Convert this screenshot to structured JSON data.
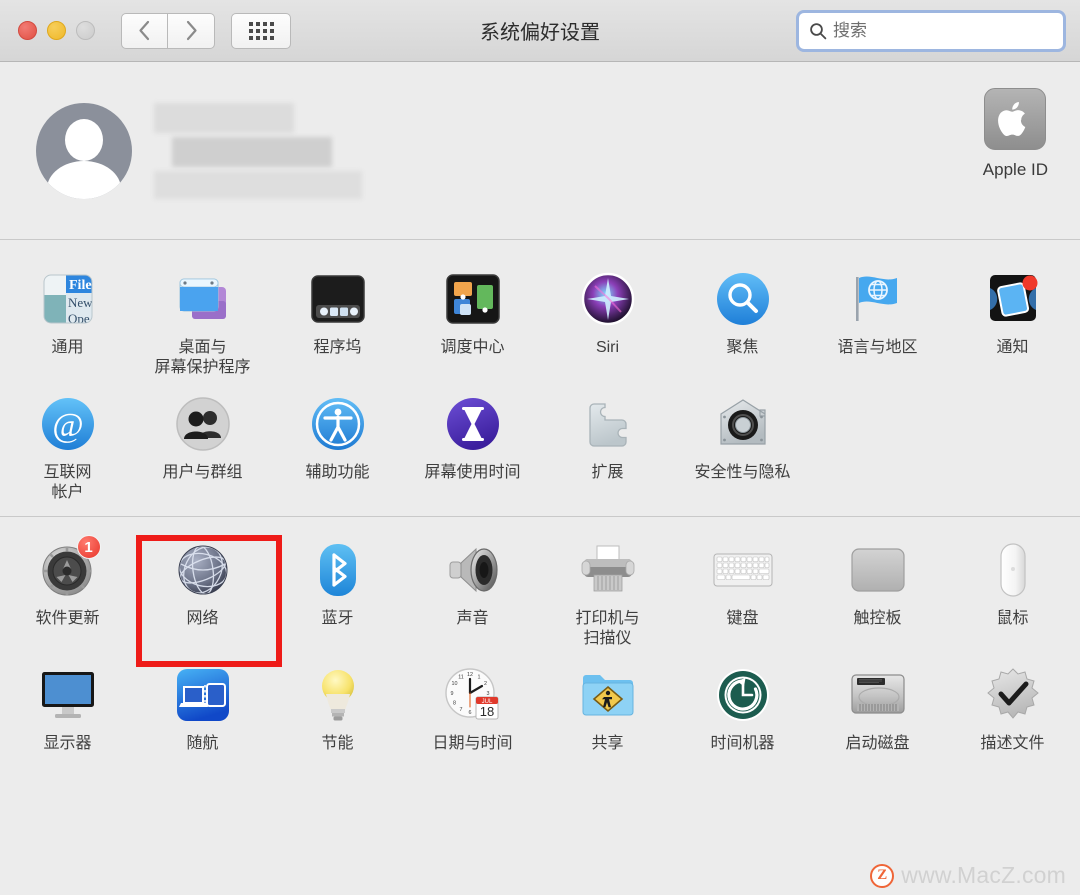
{
  "window": {
    "title": "系统偏好设置",
    "traffic_lights": [
      "close",
      "minimize",
      "zoom"
    ],
    "nav_back_label": "‹",
    "nav_forward_label": "›",
    "grid_button_label": "show-all"
  },
  "search": {
    "placeholder": "搜索",
    "value": "",
    "focused": true,
    "focus_ring_color": "#9db6e0"
  },
  "account": {
    "name_redacted": true,
    "apple_id": {
      "label": "Apple ID",
      "icon": "apple-logo-icon"
    }
  },
  "sections": [
    {
      "id": "section-general",
      "items": [
        {
          "label": "通用",
          "icon": "general-icon"
        },
        {
          "label": "桌面与\n屏幕保护程序",
          "icon": "desktop-screensaver-icon"
        },
        {
          "label": "程序坞",
          "icon": "dock-icon"
        },
        {
          "label": "调度中心",
          "icon": "mission-control-icon"
        },
        {
          "label": "Siri",
          "icon": "siri-icon"
        },
        {
          "label": "聚焦",
          "icon": "spotlight-icon"
        },
        {
          "label": "语言与地区",
          "icon": "language-region-icon"
        },
        {
          "label": "通知",
          "icon": "notifications-icon"
        },
        {
          "label": "互联网\n帐户",
          "icon": "internet-accounts-icon"
        },
        {
          "label": "用户与群组",
          "icon": "users-groups-icon"
        },
        {
          "label": "辅助功能",
          "icon": "accessibility-icon"
        },
        {
          "label": "屏幕使用时间",
          "icon": "screen-time-icon"
        },
        {
          "label": "扩展",
          "icon": "extensions-icon"
        },
        {
          "label": "安全性与隐私",
          "icon": "security-privacy-icon"
        }
      ]
    },
    {
      "id": "section-hardware",
      "items": [
        {
          "label": "软件更新",
          "icon": "software-update-icon",
          "badge": "1"
        },
        {
          "label": "网络",
          "icon": "network-icon",
          "highlighted": true
        },
        {
          "label": "蓝牙",
          "icon": "bluetooth-icon"
        },
        {
          "label": "声音",
          "icon": "sound-icon"
        },
        {
          "label": "打印机与\n扫描仪",
          "icon": "printers-scanners-icon"
        },
        {
          "label": "键盘",
          "icon": "keyboard-icon"
        },
        {
          "label": "触控板",
          "icon": "trackpad-icon"
        },
        {
          "label": "鼠标",
          "icon": "mouse-icon"
        },
        {
          "label": "显示器",
          "icon": "displays-icon"
        },
        {
          "label": "随航",
          "icon": "sidecar-icon"
        },
        {
          "label": "节能",
          "icon": "energy-saver-icon"
        },
        {
          "label": "日期与时间",
          "icon": "date-time-icon",
          "calendar_month": "JUL",
          "calendar_day": "18"
        },
        {
          "label": "共享",
          "icon": "sharing-icon"
        },
        {
          "label": "时间机器",
          "icon": "time-machine-icon"
        },
        {
          "label": "启动磁盘",
          "icon": "startup-disk-icon"
        },
        {
          "label": "描述文件",
          "icon": "profiles-icon"
        }
      ]
    }
  ],
  "highlight": {
    "color": "#ee1b18",
    "target_label": "网络"
  },
  "watermark": {
    "logo_letter": "Z",
    "text": "www.MacZ.com",
    "color": "#f05a28"
  }
}
